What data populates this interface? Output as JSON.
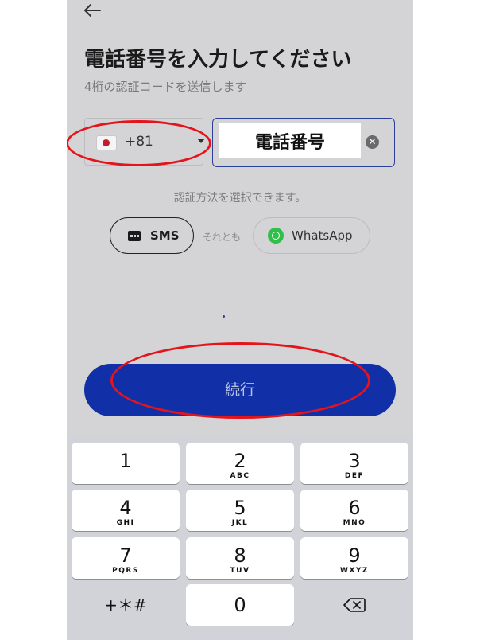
{
  "header": {
    "title": "電話番号を入力してください",
    "subtitle": "4桁の認証コードを送信します"
  },
  "phone_input": {
    "country_code": "+81",
    "country_flag": "japan-flag-icon",
    "value": "電話番号"
  },
  "verification": {
    "hint": "認証方法を選択できます。",
    "sms_label": "SMS",
    "or_text": "それとも",
    "whatsapp_label": "WhatsApp"
  },
  "continue_button": {
    "label": "続行"
  },
  "keypad": {
    "keys": [
      {
        "num": "1",
        "letters": ""
      },
      {
        "num": "2",
        "letters": "ABC"
      },
      {
        "num": "3",
        "letters": "DEF"
      },
      {
        "num": "4",
        "letters": "GHI"
      },
      {
        "num": "5",
        "letters": "JKL"
      },
      {
        "num": "6",
        "letters": "MNO"
      },
      {
        "num": "7",
        "letters": "PQRS"
      },
      {
        "num": "8",
        "letters": "TUV"
      },
      {
        "num": "9",
        "letters": "WXYZ"
      },
      {
        "num": "0",
        "letters": ""
      }
    ],
    "symbols_label": "+＊#"
  },
  "colors": {
    "accent": "#1130a8",
    "annotation": "#e4141c",
    "background": "#d4d4d6"
  }
}
